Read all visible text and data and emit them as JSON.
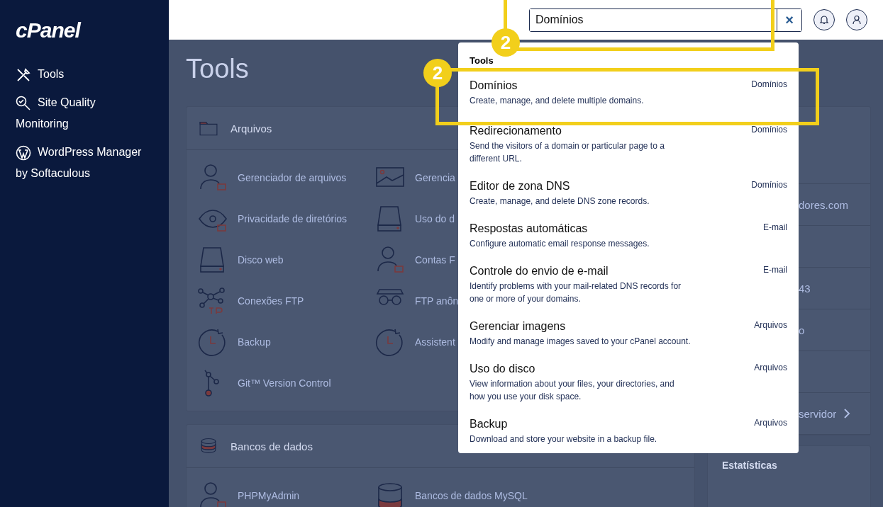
{
  "sidebar": {
    "logo": "cPanel",
    "items": [
      {
        "label": "Tools"
      },
      {
        "label": "Site Quality Monitoring"
      },
      {
        "label": "WordPress Manager by Softaculous"
      }
    ]
  },
  "topbar": {
    "search": {
      "value": "Domínios",
      "clear": "×"
    }
  },
  "page": {
    "title": "Tools",
    "sections": [
      {
        "title": "Arquivos",
        "items": [
          "Gerenciador de arquivos",
          "Gerencia",
          "Privacidade de diretórios",
          "Uso do d",
          "Disco web",
          "Contas F",
          "Conexões FTP",
          "FTP anôn",
          "Backup",
          "Assistent",
          "Git™ Version Control"
        ]
      },
      {
        "title": "Bancos de dados",
        "items": [
          "PHPMyAdmin",
          "Bancos de dados MySQL"
        ]
      }
    ],
    "side_rows": [
      "",
      "dores.com",
      "",
      "43",
      "o",
      "",
      "servidor"
    ],
    "stats_title": "Estatísticas"
  },
  "search_results": {
    "heading": "Tools",
    "items": [
      {
        "title": "Domínios",
        "description": "Create, manage, and delete multiple domains.",
        "category": "Domínios"
      },
      {
        "title": "Redirecionamento",
        "description": "Send the visitors of a domain or particular page to a\ndifferent URL.",
        "category": "Domínios"
      },
      {
        "title": "Editor de zona DNS",
        "description": "Create, manage, and delete DNS zone records.",
        "category": "Domínios"
      },
      {
        "title": "Respostas automáticas",
        "description": "Configure automatic email response messages.",
        "category": "E-mail"
      },
      {
        "title": "Controle do envio de e-mail",
        "description": "Identify problems with your mail-related DNS records for\none or more of your domains.",
        "category": "E-mail"
      },
      {
        "title": "Gerenciar imagens",
        "description": "Modify and manage images saved to your cPanel account.",
        "category": "Arquivos"
      },
      {
        "title": "Uso do disco",
        "description": "View information about your files, your directories, and\nhow you use your disk space.",
        "category": "Arquivos"
      },
      {
        "title": "Backup",
        "description": "Download and store your website in a backup file.",
        "category": "Arquivos"
      }
    ]
  },
  "callouts": [
    {
      "number": "2"
    },
    {
      "number": "2"
    }
  ]
}
